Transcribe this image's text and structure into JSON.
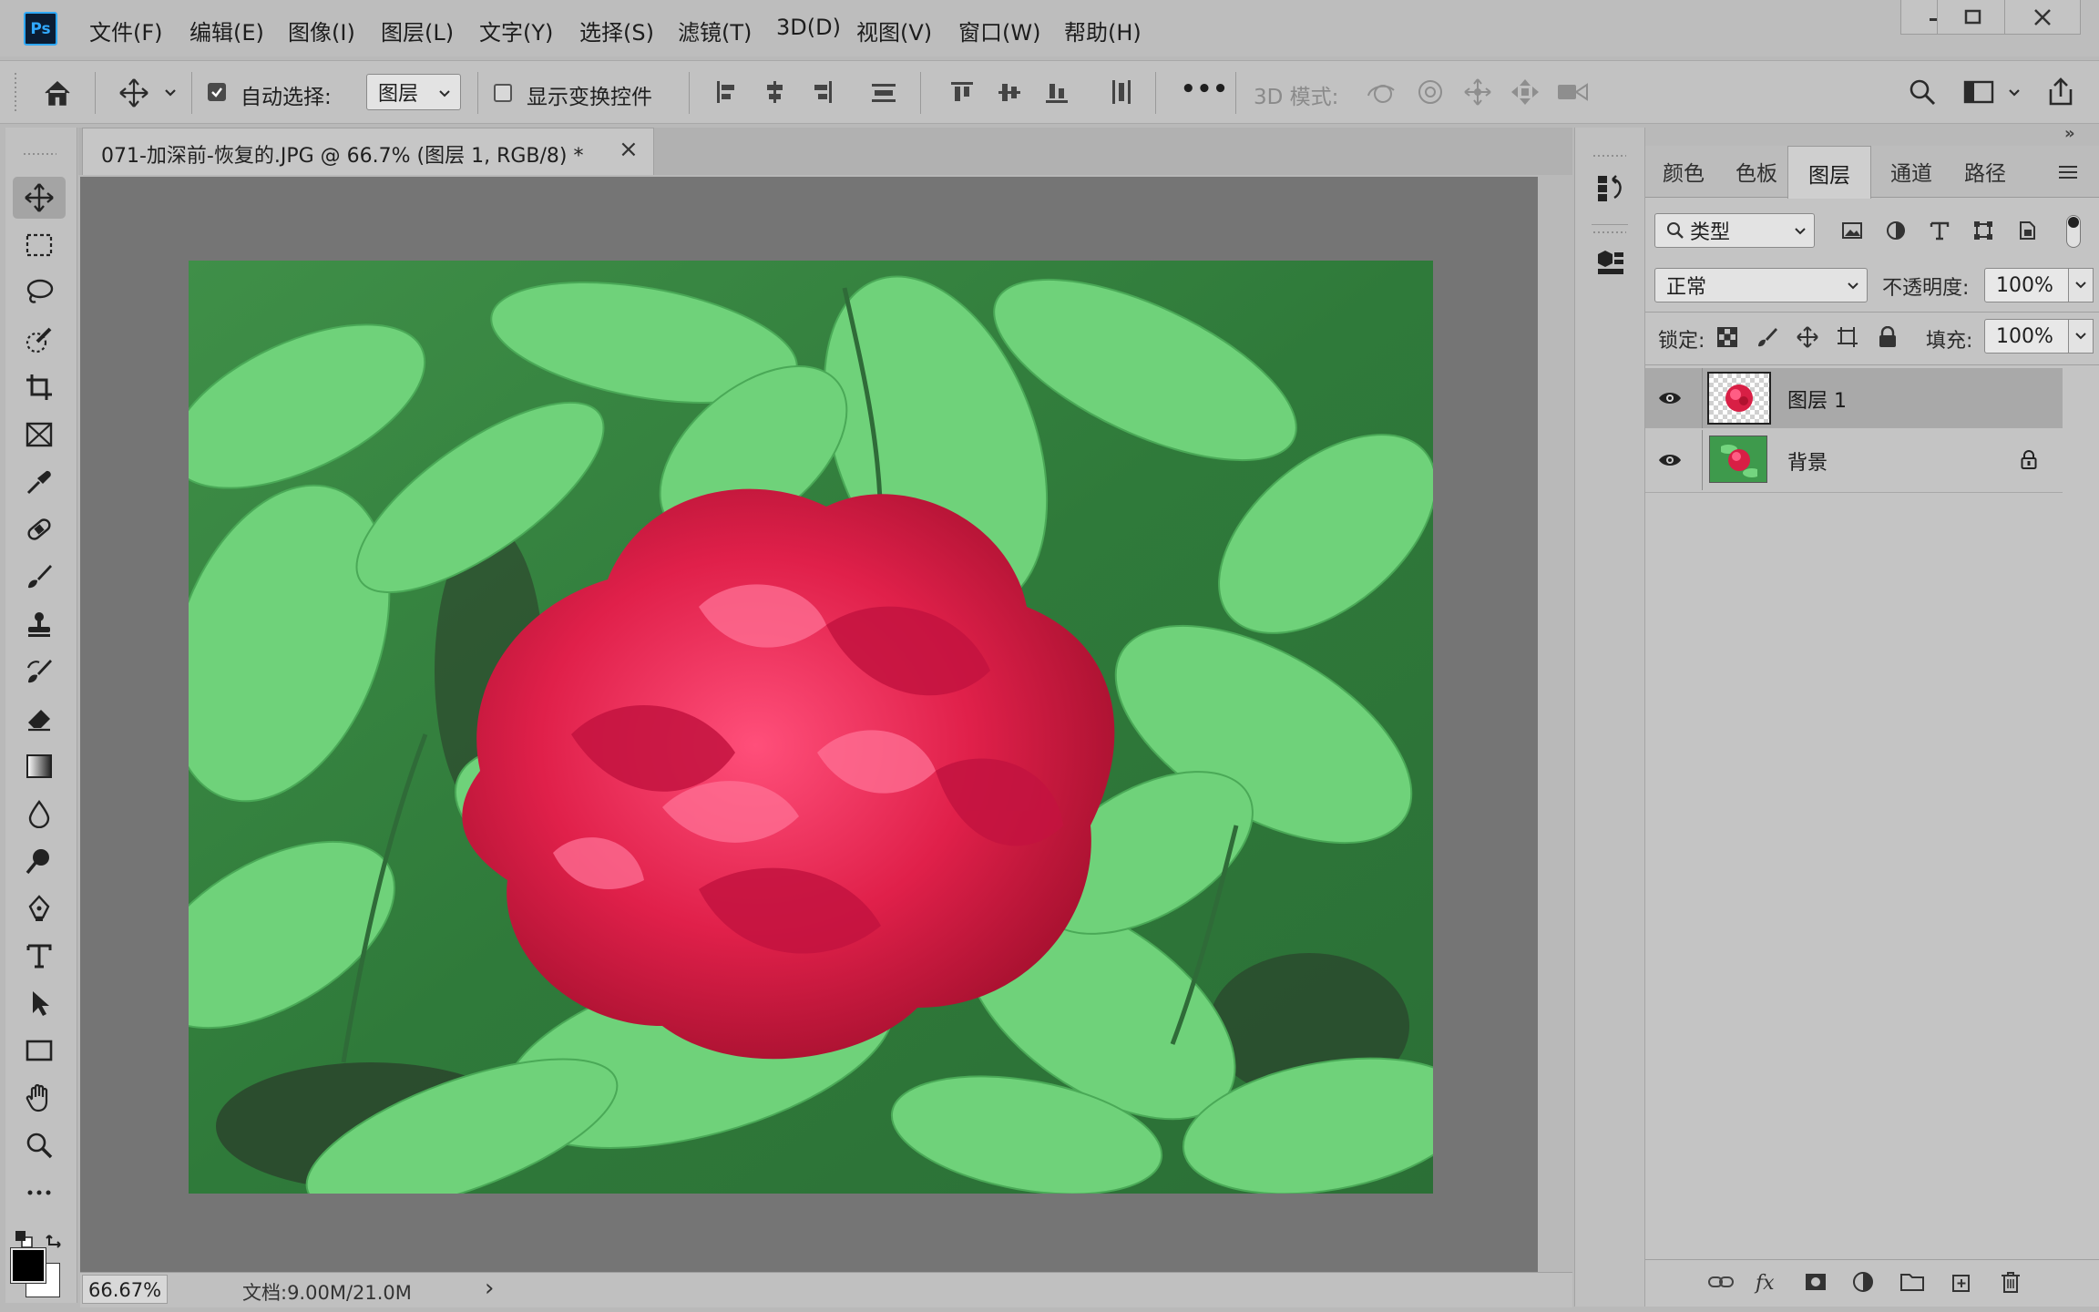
{
  "app": {
    "logo": "Ps"
  },
  "menu": [
    "文件(F)",
    "编辑(E)",
    "图像(I)",
    "图层(L)",
    "文字(Y)",
    "选择(S)",
    "滤镜(T)",
    "3D(D)",
    "视图(V)",
    "窗口(W)",
    "帮助(H)"
  ],
  "options": {
    "auto_select_label": "自动选择:",
    "auto_select_checked": true,
    "auto_select_target": "图层",
    "show_transform_label": "显示变换控件",
    "show_transform_checked": false,
    "more": "•••",
    "mode3d_label": "3D 模式:"
  },
  "document": {
    "tab_title": "071-加深前-恢复的.JPG @ 66.7% (图层 1, RGB/8) *",
    "close_glyph": "×",
    "zoom": "66.67%",
    "doc_info": "文档:9.00M/21.0M",
    "status_arrow": "›"
  },
  "panel": {
    "tabs": [
      "颜色",
      "色板",
      "图层",
      "通道",
      "路径"
    ],
    "active_tab": 2,
    "filter_kind": "类型",
    "blend_mode": "正常",
    "opacity_label": "不透明度:",
    "opacity": "100%",
    "lock_label": "锁定:",
    "fill_label": "填充:",
    "fill": "100%",
    "layers": [
      {
        "name": "图层 1",
        "visible": true,
        "selected": true,
        "locked": false
      },
      {
        "name": "背景",
        "visible": true,
        "selected": false,
        "locked": true
      }
    ]
  },
  "collapse": {
    "left": "»",
    "right": "»",
    "dock": "«"
  },
  "colors": {
    "accent": "#31a8ff",
    "foreground": "#000000",
    "background": "#ffffff",
    "flower": "#d81f45",
    "leaf": "#5fc56a"
  },
  "icons": {
    "toolbar": [
      "move-icon",
      "marquee-icon",
      "lasso-icon",
      "quick-select-icon",
      "crop-icon",
      "frame-icon",
      "eyedropper-icon",
      "healing-icon",
      "brush-icon",
      "stamp-icon",
      "history-brush-icon",
      "eraser-icon",
      "gradient-icon",
      "blur-icon",
      "dodge-icon",
      "pen-icon",
      "type-icon",
      "path-select-icon",
      "rectangle-icon",
      "hand-icon",
      "zoom-icon",
      "more-tools-icon"
    ]
  }
}
